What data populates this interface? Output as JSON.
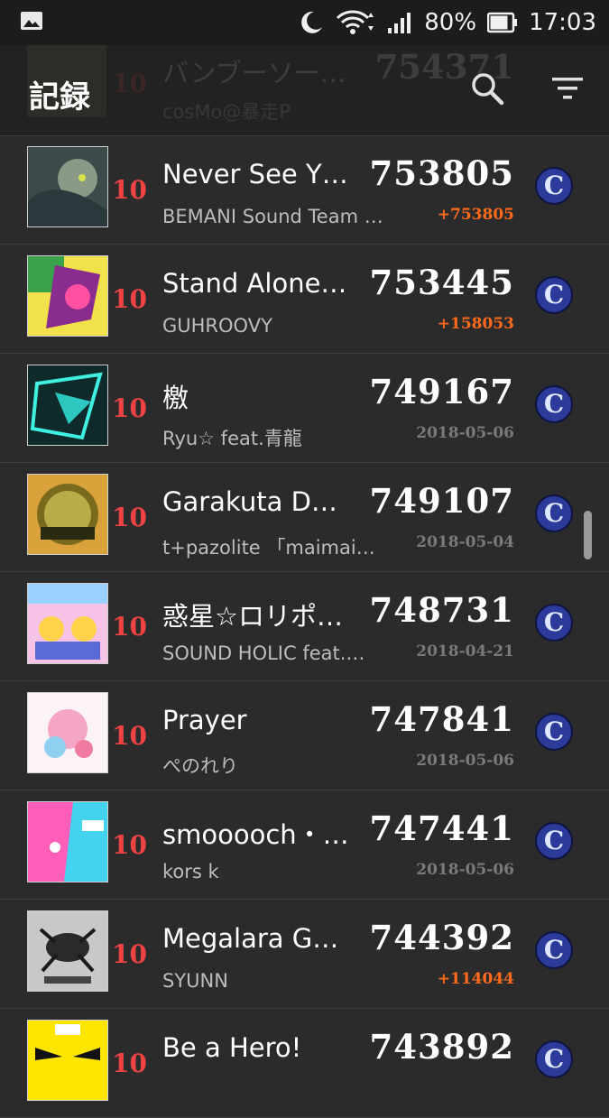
{
  "status": {
    "battery": "80%",
    "time": "17:03"
  },
  "toolbar": {
    "title": "記録"
  },
  "behind_row": {
    "title": "バンブーソー…",
    "artist": "cosMo@暴走P",
    "level": "10",
    "score": "754371"
  },
  "rows": [
    {
      "level": "10",
      "title": "Never See Y…",
      "artist": "BEMANI Sound Team \"…",
      "score": "753805",
      "sub": "+753805",
      "sub_type": "diff",
      "rank": "C"
    },
    {
      "level": "10",
      "title": "Stand Alone…",
      "artist": "GUHROOVY",
      "score": "753445",
      "sub": "+158053",
      "sub_type": "diff",
      "rank": "C"
    },
    {
      "level": "10",
      "title": "檄",
      "artist": "Ryu☆ feat.青龍",
      "score": "749167",
      "sub": "2018-05-06",
      "sub_type": "date",
      "rank": "C"
    },
    {
      "level": "10",
      "title": "Garakuta D…",
      "artist": "t+pazolite 「maimai…",
      "score": "749107",
      "sub": "2018-05-04",
      "sub_type": "date",
      "rank": "C"
    },
    {
      "level": "10",
      "title": "惑星☆ロリポ…",
      "artist": "SOUND HOLIC feat.…",
      "score": "748731",
      "sub": "2018-04-21",
      "sub_type": "date",
      "rank": "C"
    },
    {
      "level": "10",
      "title": "Prayer",
      "artist": "ぺのれり",
      "score": "747841",
      "sub": "2018-05-06",
      "sub_type": "date",
      "rank": "C"
    },
    {
      "level": "10",
      "title": "smooooch・…",
      "artist": "kors k",
      "score": "747441",
      "sub": "2018-05-06",
      "sub_type": "date",
      "rank": "C"
    },
    {
      "level": "10",
      "title": "Megalara G…",
      "artist": "SYUNN",
      "score": "744392",
      "sub": "+114044",
      "sub_type": "diff",
      "rank": "C"
    },
    {
      "level": "10",
      "title": "Be a Hero!",
      "artist": "",
      "score": "743892",
      "sub": "",
      "sub_type": "date",
      "rank": "C"
    }
  ]
}
